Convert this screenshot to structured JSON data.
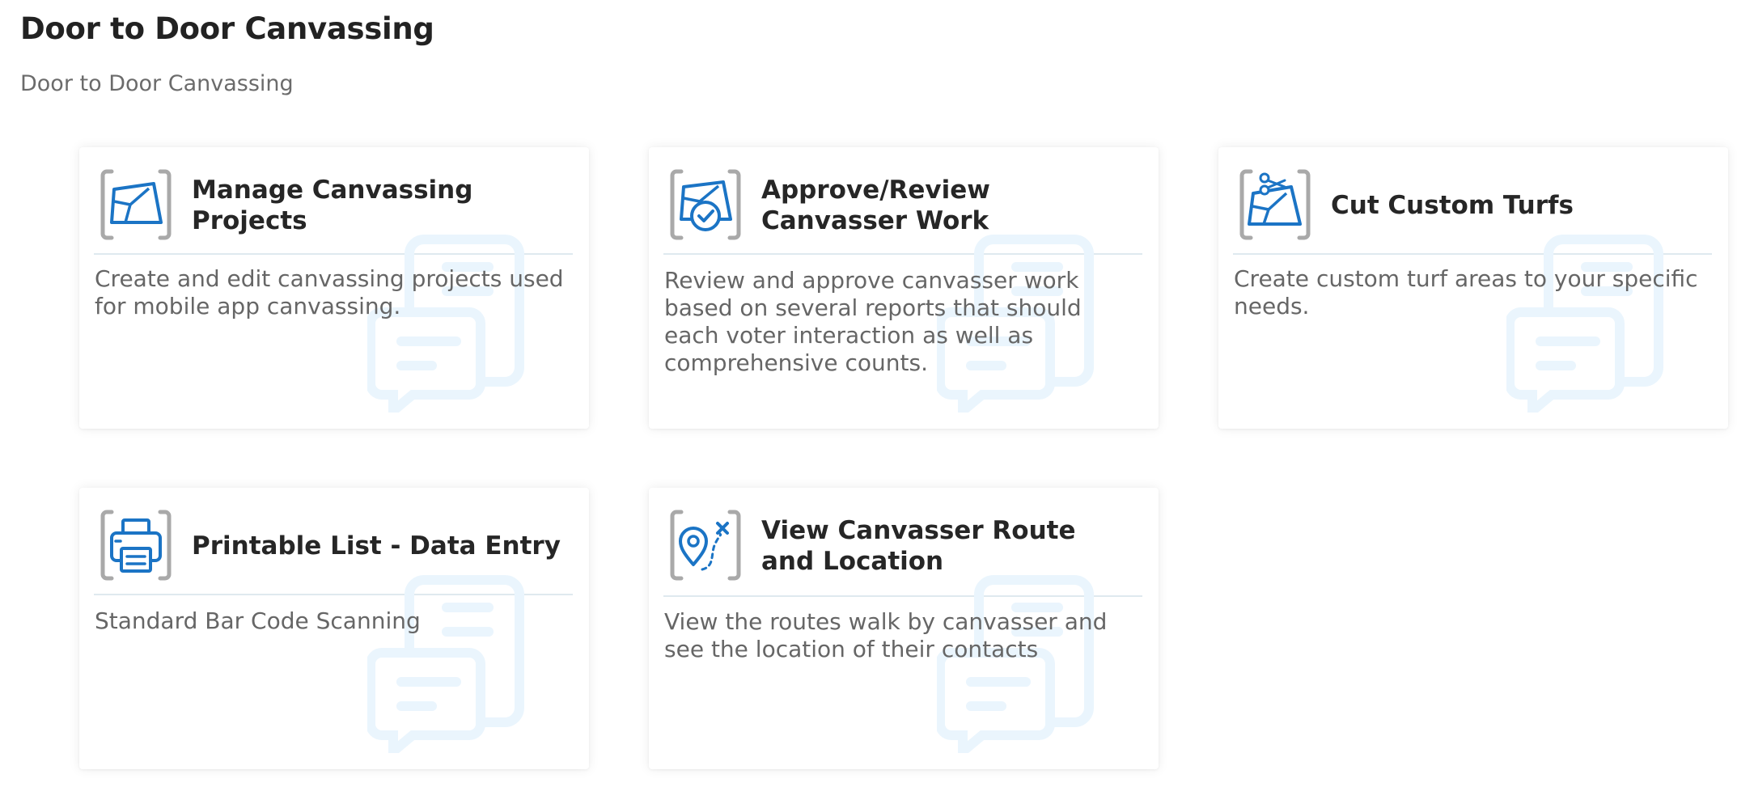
{
  "page": {
    "title": "Door to Door Canvassing",
    "subtitle": "Door to Door Canvassing"
  },
  "colors": {
    "icon_blue": "#1b74c5",
    "icon_frame": "#a9a9a9",
    "watermark": "#eaf5fd",
    "divider": "#dfe9ef"
  },
  "cards": [
    {
      "title": "Manage Canvassing Projects",
      "description": "Create and edit canvassing projects used for mobile app canvassing.",
      "icon": "map-icon"
    },
    {
      "title": "Approve/Review Canvasser Work",
      "description": "Review and approve canvasser work based on several reports that should each voter interaction as well as comprehensive counts.",
      "icon": "map-check-icon"
    },
    {
      "title": "Cut Custom Turfs",
      "description": "Create custom turf areas to your specific needs.",
      "icon": "map-scissors-icon"
    },
    {
      "title": "Printable List - Data Entry",
      "description": "Standard Bar Code Scanning",
      "icon": "printer-icon"
    },
    {
      "title": "View Canvasser Route and Location",
      "description": "View the routes walk by canvasser and see the location of their contacts",
      "icon": "route-pin-icon"
    }
  ]
}
